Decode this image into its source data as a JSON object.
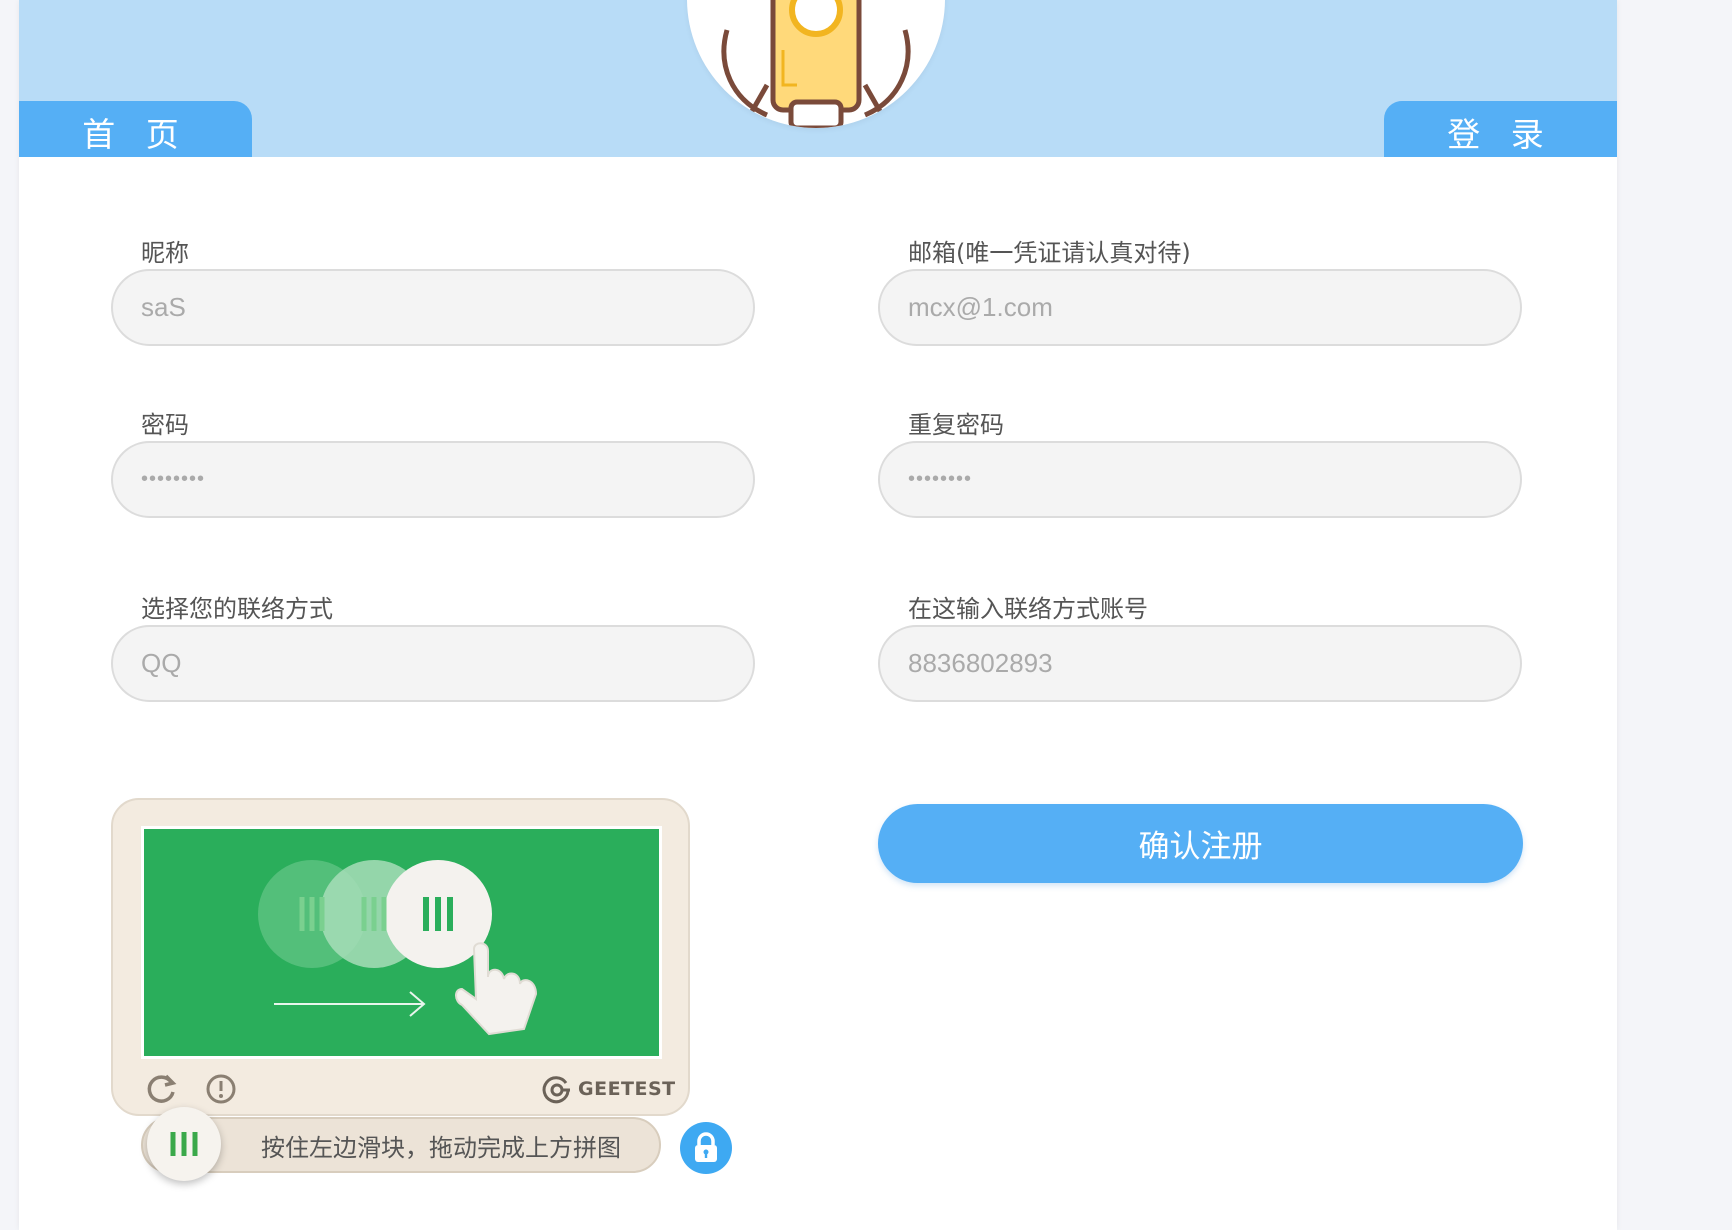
{
  "nav": {
    "home_label": "首 页",
    "login_label": "登 录"
  },
  "form": {
    "nickname": {
      "label": "昵称",
      "value": "saS"
    },
    "email": {
      "label": "邮箱(唯一凭证请认真对待)",
      "value": "mcx@1.com"
    },
    "password": {
      "label": "密码",
      "value": "••••••••"
    },
    "repeat_password": {
      "label": "重复密码",
      "value": "••••••••"
    },
    "contact_type": {
      "label": "选择您的联络方式",
      "value": "QQ"
    },
    "contact_account": {
      "label": "在这输入联络方式账号",
      "value": "8836802893"
    },
    "submit_label": "确认注册"
  },
  "captcha": {
    "brand": "GEETEST",
    "slider_hint": "按住左边滑块，拖动完成上方拼图"
  },
  "colors": {
    "accent": "#55aff5",
    "header_bg": "#b8dcf7",
    "captcha_green": "#2aae5b"
  },
  "icons": [
    "rocket-avatar-icon",
    "refresh-icon",
    "feedback-icon",
    "geetest-logo-icon",
    "slider-grip-icon",
    "lock-icon"
  ]
}
